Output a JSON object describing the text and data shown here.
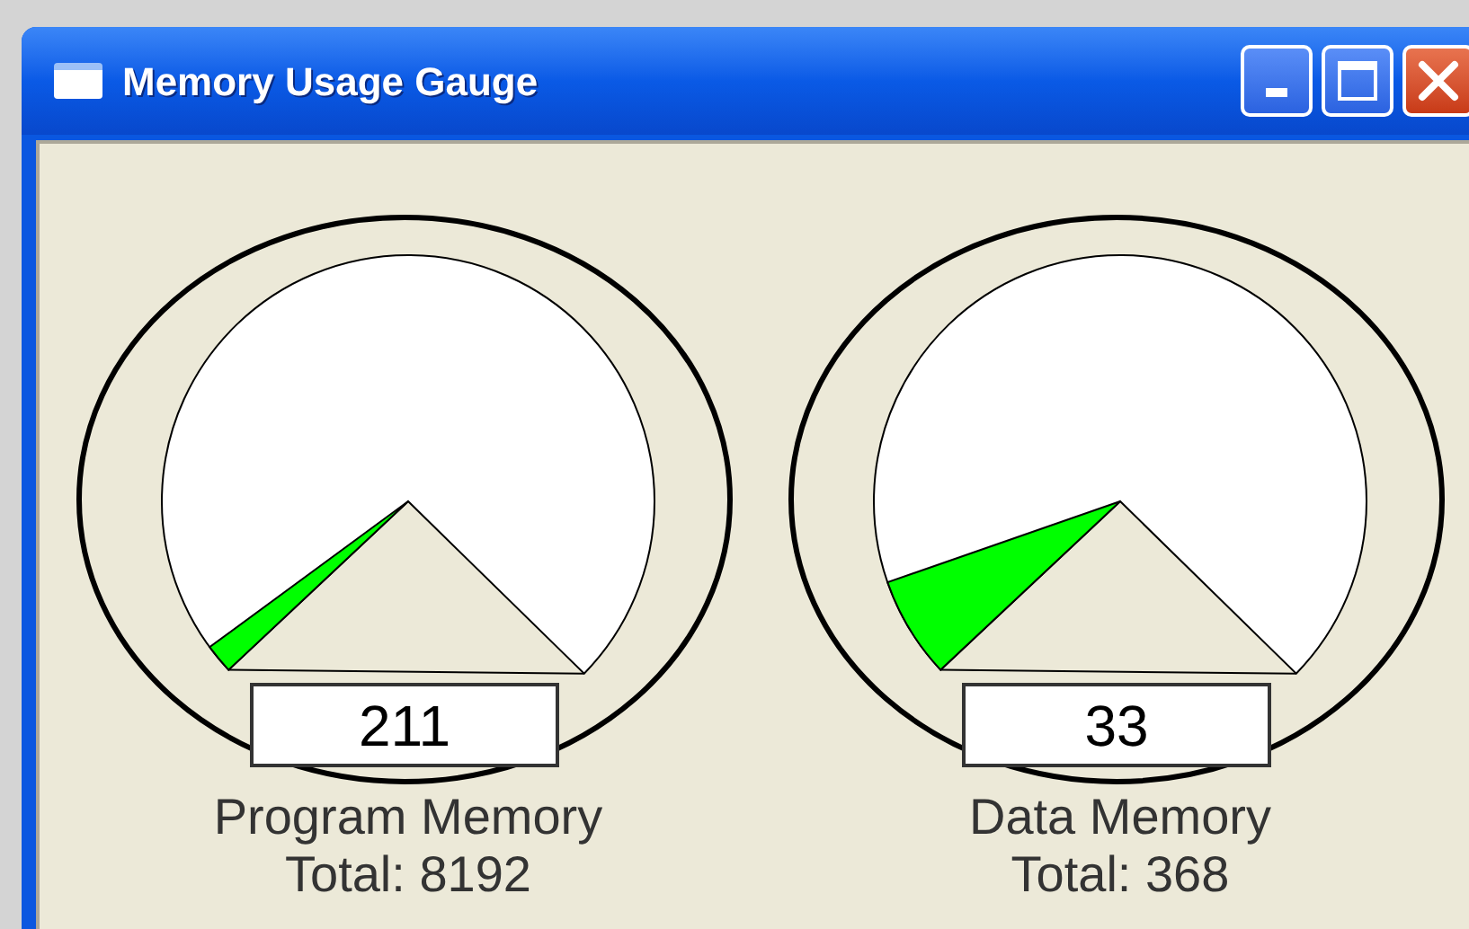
{
  "window": {
    "title": "Memory Usage Gauge",
    "buttons": [
      {
        "kind": "minimize"
      },
      {
        "kind": "maximize"
      },
      {
        "kind": "close"
      }
    ]
  },
  "gauges": [
    {
      "value": "211",
      "label": "Program Memory",
      "total": "Total: 8192"
    },
    {
      "value": "33",
      "label": "Data Memory",
      "total": "Total: 368"
    }
  ]
}
